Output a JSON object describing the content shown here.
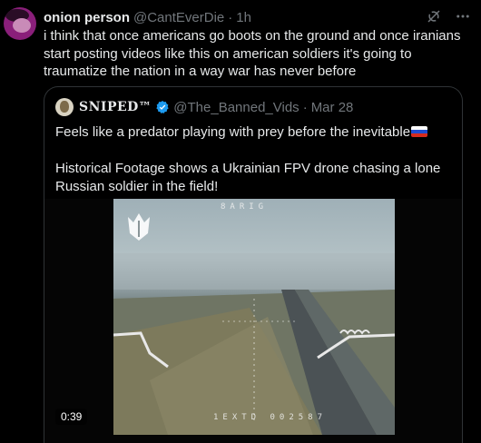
{
  "tweet": {
    "display_name": "onion person",
    "handle": "@CantEverDie",
    "separator": "·",
    "time": "1h",
    "text": "i think that once americans go boots on the ground and once iranians start posting videos like this on american soldiers it's going to traumatize the nation in a way war has never before",
    "icons": [
      "grok-icon",
      "more-icon"
    ]
  },
  "quote": {
    "display_name": "SNIPED™",
    "handle": "@The_Banned_Vids",
    "separator": "·",
    "time": "Mar 28",
    "paragraph_1": "Feels like a predator playing with prey before the inevitable",
    "paragraph_2": "Historical Footage shows a Ukrainian FPV drone chasing  a lone Russian soldier in the field!",
    "flag_icon": "russia-flag-icon",
    "verified_color": "#1d9bf0"
  },
  "video": {
    "duration": "0:39",
    "osd_top": "8ARIG",
    "osd_bottom": "1EXTD 002587"
  },
  "colors": {
    "background": "#000000",
    "text": "#e7e9ea",
    "secondary": "#71767b",
    "border": "#2f3336"
  }
}
